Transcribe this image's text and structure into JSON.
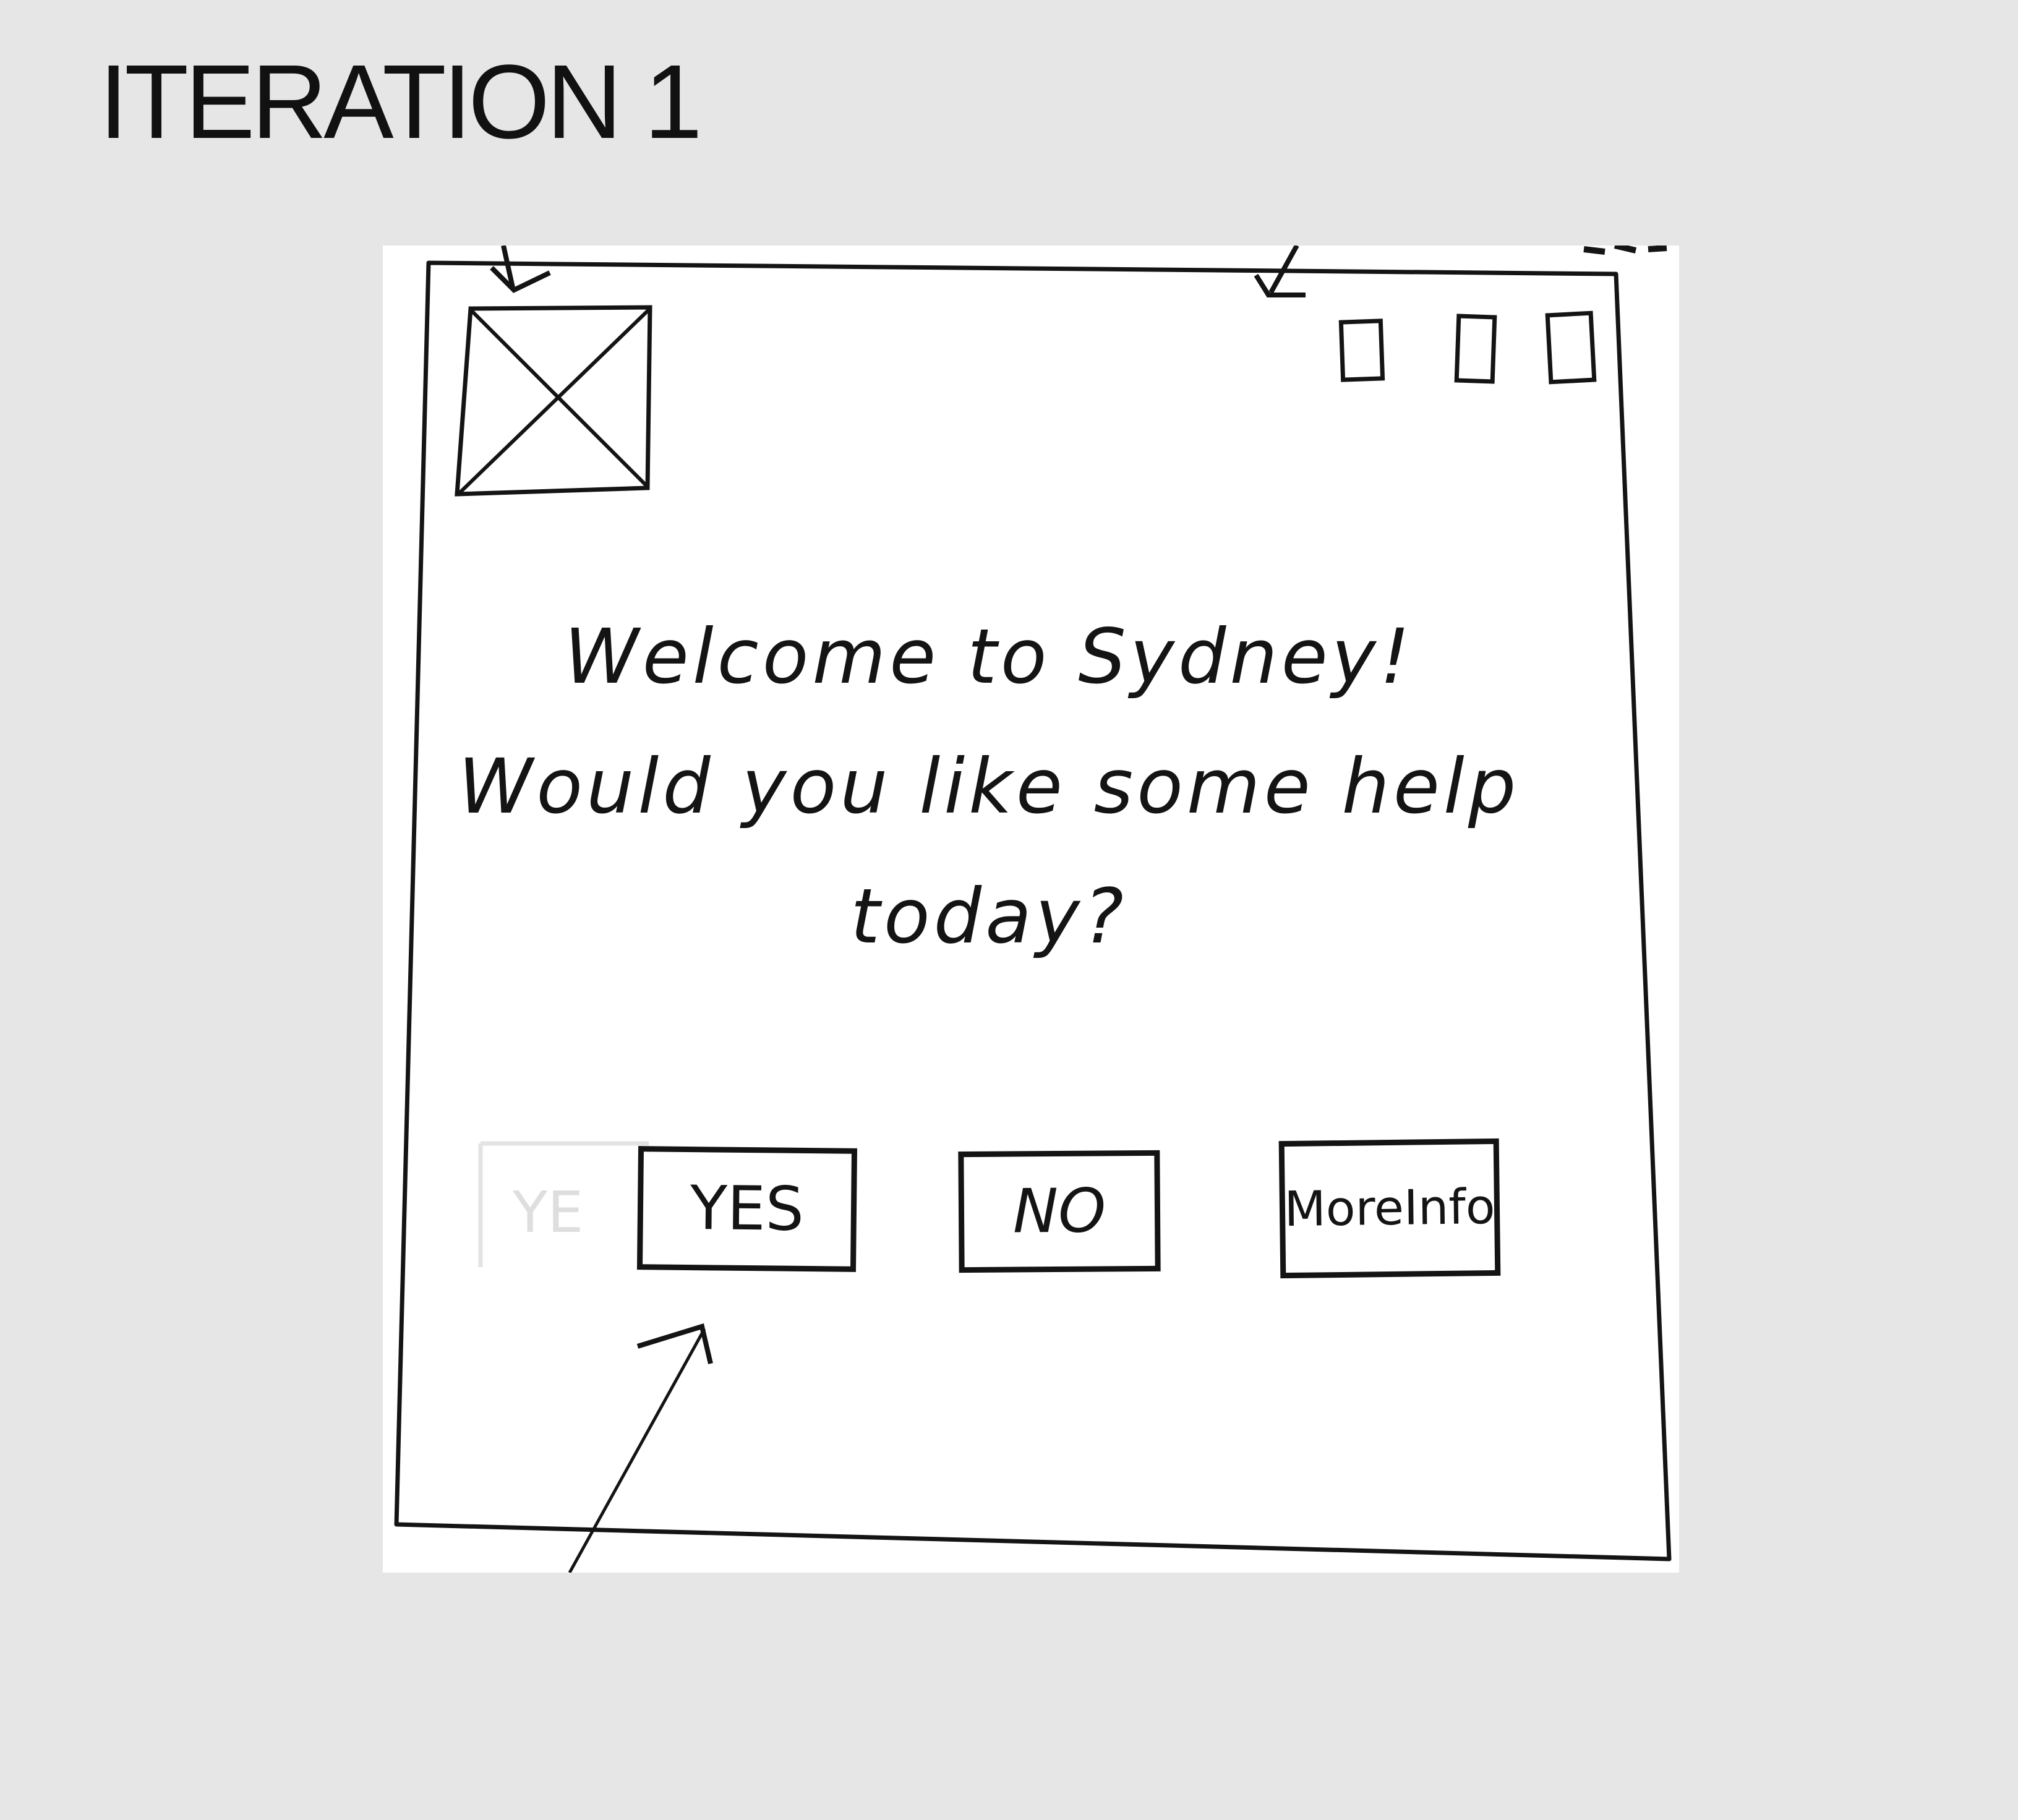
{
  "page": {
    "title": "ITERATION 1"
  },
  "dialog": {
    "header": {
      "logo_icon": "image-placeholder-icon",
      "window_controls": [
        "window-control-icon",
        "window-control-icon",
        "window-control-icon"
      ]
    },
    "message": {
      "line1": "Welcome to Sydney!",
      "line2": "Would you like some help",
      "line3": "today?"
    },
    "buttons": {
      "faded_label": "YE",
      "yes_label": "YES",
      "no_label": "NO",
      "more_info_line1": "More",
      "more_info_line2": "Info"
    }
  },
  "colors": {
    "page_background": "#e6e6e6",
    "paper": "#ffffff",
    "ink": "#141414"
  }
}
